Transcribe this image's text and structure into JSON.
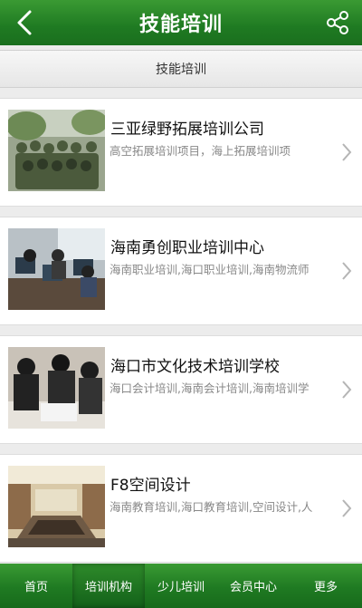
{
  "header": {
    "title": "技能培训",
    "back_icon": "chevron-left-icon",
    "share_icon": "share-icon"
  },
  "subheader": {
    "label": "技能培训"
  },
  "items": [
    {
      "name": "三亚绿野拓展培训公司",
      "desc": "高空拓展培训项目，海上拓展培训项"
    },
    {
      "name": "海南勇创职业培训中心",
      "desc": "海南职业培训,海口职业培训,海南物流师"
    },
    {
      "name": "海口市文化技术培训学校",
      "desc": "海口会计培训,海南会计培训,海南培训学"
    },
    {
      "name": "F8空间设计",
      "desc": "海南教育培训,海口教育培训,空间设计,人"
    }
  ],
  "tabbar": {
    "tabs": [
      {
        "label": "首页"
      },
      {
        "label": "培训机构"
      },
      {
        "label": "少儿培训"
      },
      {
        "label": "会员中心"
      },
      {
        "label": "更多"
      }
    ],
    "active_index": 1
  },
  "colors": {
    "brand_green": "#1f7a22"
  }
}
